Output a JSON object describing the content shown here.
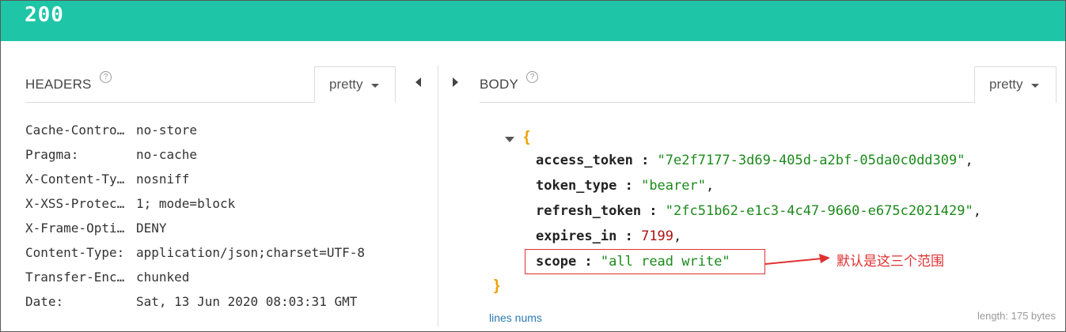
{
  "status": {
    "code": "200"
  },
  "headers_panel": {
    "title": "HEADERS",
    "help_glyph": "?",
    "format_label": "pretty",
    "rows": [
      {
        "key": "Cache-Contro…",
        "value": "no-store"
      },
      {
        "key": "Pragma:",
        "value": "no-cache"
      },
      {
        "key": "X-Content-Ty…",
        "value": "nosniff"
      },
      {
        "key": "X-XSS-Protec…",
        "value": "1; mode=block"
      },
      {
        "key": "X-Frame-Opti…",
        "value": "DENY"
      },
      {
        "key": "Content-Type:",
        "value": "application/json;charset=UTF-8"
      },
      {
        "key": "Transfer-Enc…",
        "value": "chunked"
      },
      {
        "key": "Date:",
        "value": "Sat, 13 Jun 2020 08:03:31 GMT"
      }
    ]
  },
  "body_panel": {
    "title": "BODY",
    "help_glyph": "?",
    "format_label": "pretty",
    "open_brace": "{",
    "close_brace": "}",
    "fields": [
      {
        "key": "access_token",
        "value": "\"7e2f7177-3d69-405d-a2bf-05da0c0dd309\"",
        "type": "string"
      },
      {
        "key": "token_type",
        "value": "\"bearer\"",
        "type": "string"
      },
      {
        "key": "refresh_token",
        "value": "\"2fc51b62-e1c3-4c47-9660-e675c2021429\"",
        "type": "string"
      },
      {
        "key": "expires_in",
        "value": "7199",
        "type": "number"
      },
      {
        "key": "scope",
        "value": "\"all read write\"",
        "type": "string"
      }
    ],
    "lines_nums_label": "lines nums",
    "length_label": "length: 175 bytes"
  },
  "annotation": {
    "text": "默认是这三个范围",
    "color": "#e03131"
  },
  "colors": {
    "status_bar": "#1ec5a6",
    "json_string": "#1c8a1c",
    "json_number": "#a11",
    "brace": "#f0a000"
  }
}
